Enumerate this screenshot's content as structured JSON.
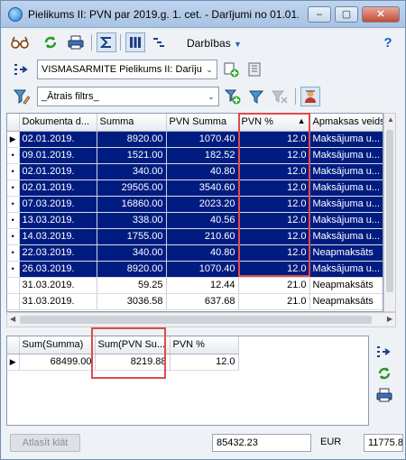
{
  "window": {
    "title": "Pielikums II: PVN par 2019.g. 1. cet. - Darījumi no 01.01.2...",
    "minimize": "–",
    "restore": "▢",
    "close": "✕"
  },
  "toolbar": {
    "menu_label": "Darbības"
  },
  "report_combo": {
    "value": "VISMASARMITE Pielikums II: Darījumi"
  },
  "filter_combo": {
    "value": "_Ātrais filtrs_"
  },
  "grid": {
    "columns": [
      "Dokumenta d...",
      "Summa",
      "PVN Summa",
      "PVN %",
      "Apmaksas veids"
    ],
    "sort_indicator": "▲",
    "rows": [
      {
        "date": "02.01.2019.",
        "summa": "8920.00",
        "pvn": "1070.40",
        "pct": "12.0",
        "veids": "Maksājuma u...",
        "selected": true,
        "indicator": "▶"
      },
      {
        "date": "09.01.2019.",
        "summa": "1521.00",
        "pvn": "182.52",
        "pct": "12.0",
        "veids": "Maksājuma u...",
        "selected": true,
        "indicator": "•"
      },
      {
        "date": "02.01.2019.",
        "summa": "340.00",
        "pvn": "40.80",
        "pct": "12.0",
        "veids": "Maksājuma u...",
        "selected": true,
        "indicator": "•"
      },
      {
        "date": "02.01.2019.",
        "summa": "29505.00",
        "pvn": "3540.60",
        "pct": "12.0",
        "veids": "Maksājuma u...",
        "selected": true,
        "indicator": "•"
      },
      {
        "date": "07.03.2019.",
        "summa": "16860.00",
        "pvn": "2023.20",
        "pct": "12.0",
        "veids": "Maksājuma u...",
        "selected": true,
        "indicator": "•"
      },
      {
        "date": "13.03.2019.",
        "summa": "338.00",
        "pvn": "40.56",
        "pct": "12.0",
        "veids": "Maksājuma u...",
        "selected": true,
        "indicator": "•"
      },
      {
        "date": "14.03.2019.",
        "summa": "1755.00",
        "pvn": "210.60",
        "pct": "12.0",
        "veids": "Maksājuma u...",
        "selected": true,
        "indicator": "•"
      },
      {
        "date": "22.03.2019.",
        "summa": "340.00",
        "pvn": "40.80",
        "pct": "12.0",
        "veids": "Neapmaksāts",
        "selected": true,
        "indicator": "•"
      },
      {
        "date": "26.03.2019.",
        "summa": "8920.00",
        "pvn": "1070.40",
        "pct": "12.0",
        "veids": "Maksājuma u...",
        "selected": true,
        "indicator": "•"
      },
      {
        "date": "31.03.2019.",
        "summa": "59.25",
        "pvn": "12.44",
        "pct": "21.0",
        "veids": "Neapmaksāts",
        "selected": false,
        "indicator": ""
      },
      {
        "date": "31.03.2019.",
        "summa": "3036.58",
        "pvn": "637.68",
        "pct": "21.0",
        "veids": "Neapmaksāts",
        "selected": false,
        "indicator": ""
      }
    ]
  },
  "summary": {
    "columns": [
      "Sum(Summa)",
      "Sum(PVN Su...",
      "PVN %"
    ],
    "row": {
      "indicator": "▶",
      "summa": "68499.00",
      "pvn": "8219.88",
      "pct": "12.0"
    }
  },
  "status": {
    "clear_selection_label": "Atlasīt klāt",
    "total": "85432.23",
    "currency": "EUR",
    "amount": "11775.8"
  }
}
